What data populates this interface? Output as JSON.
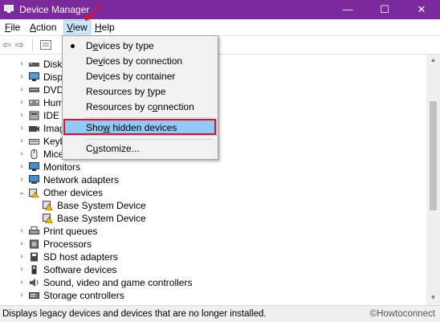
{
  "window": {
    "title": "Device Manager",
    "minimize": "—",
    "maximize": "☐",
    "close": "✕"
  },
  "menubar": [
    {
      "label": "File",
      "key": "F",
      "rest": "ile"
    },
    {
      "label": "Action",
      "key": "A",
      "rest": "ction"
    },
    {
      "label": "View",
      "key": "V",
      "rest": "iew"
    },
    {
      "label": "Help",
      "key": "H",
      "rest": "elp"
    }
  ],
  "toolbar": {
    "back": "⇦",
    "forward": "⇨"
  },
  "tree": {
    "hidden_labels": [
      "Disk",
      "Disp",
      "DVD",
      "Hum",
      "IDE A",
      "Imag",
      "Keyb",
      "Mice"
    ],
    "visible_labels": [
      "Monitors",
      "Network adapters",
      "Other devices",
      "Base System Device",
      "Base System Device",
      "Print queues",
      "Processors",
      "SD host adapters",
      "Software devices",
      "Sound, video and game controllers",
      "Storage controllers"
    ]
  },
  "view_menu": {
    "items": [
      {
        "pre": "D",
        "u": "e",
        "post": "vices by type",
        "checked": true
      },
      {
        "pre": "De",
        "u": "v",
        "post": "ices by connection",
        "checked": false
      },
      {
        "pre": "Dev",
        "u": "i",
        "post": "ces by container",
        "checked": false
      },
      {
        "pre": "Resources by ",
        "u": "t",
        "post": "ype",
        "checked": false
      },
      {
        "pre": "Resources by c",
        "u": "o",
        "post": "nnection",
        "checked": false
      }
    ],
    "show_hidden": {
      "pre": "Sho",
      "u": "w",
      "post": " hidden devices"
    },
    "customize": {
      "pre": "C",
      "u": "u",
      "post": "stomize..."
    }
  },
  "status": {
    "text": "Displays legacy devices and devices that are no longer installed.",
    "watermark": "©Howtoconnect"
  },
  "colors": {
    "titlebar": "#7a2a9a",
    "highlight": "#91c9f7",
    "annotation": "#e0102a"
  }
}
